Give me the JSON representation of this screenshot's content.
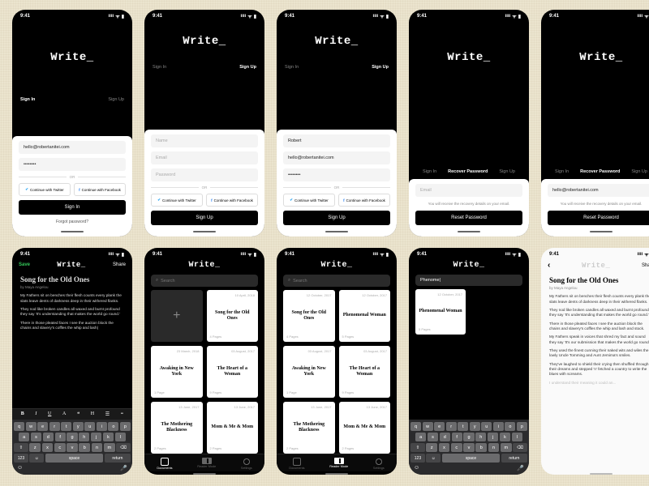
{
  "status": {
    "time": "9:41",
    "net": "ıııı",
    "wifi": "ᯤ",
    "bat": "▮"
  },
  "logo": "Write_",
  "auth": {
    "signin": "Sign In",
    "signup": "Sign Up",
    "recover": "Recover Password",
    "name_ph": "Name",
    "email_ph": "Email",
    "pass_ph": "Password",
    "email_val": "hello@robertanitei.com",
    "name_val": "Robert",
    "pass_val": "••••••••",
    "or": "OR",
    "tw": "Continue with Twitter",
    "fb": "Continue with Facebook",
    "btn_signin": "Sign In",
    "btn_signup": "Sign Up",
    "btn_reset": "Reset Password",
    "forgot": "Forgot password?",
    "note": "You will receive the recovery details on your email."
  },
  "editor": {
    "save": "Save",
    "share": "Share",
    "title": "Song for the Old Ones",
    "byline": "by Maya Angelou",
    "p1": "My Fathers sit on benches their flesh counts every plank the slats leave dents of darkness deep in their withered flanks.",
    "p2": "They nod like broken candles all waxed and burnt profound they say 'It's understanding that makes the world go round.'",
    "p3": "There in those pleated faces I see the auction block the chains and slavery's coffles the whip and lash|",
    "p3b": "There in those pleated faces I see the auction block the chains and slavery's coffles the whip and lash and stock.",
    "p4": "My Fathers speak in voices that shred my fact and sound they say 'It's our submission that makes the world go round.'",
    "p5": "They used the finest cunning their naked wits and wiles the lowly Uncle Tomming and Aunt Jemima's smiles.",
    "p6": "They've laughed to shield their crying then shuffled through their dreams and stepped 'n' fetched a country to write the blues with screams.",
    "p7": "I understand their meaning it could an..."
  },
  "fmt": {
    "b": "B",
    "i": "I",
    "u": "U",
    "a": "A",
    "q": "❝",
    "h": "H",
    "list": "☰",
    "al": "≡"
  },
  "kb": {
    "r1": [
      "q",
      "w",
      "e",
      "r",
      "t",
      "y",
      "u",
      "i",
      "o",
      "p"
    ],
    "r2": [
      "a",
      "s",
      "d",
      "f",
      "g",
      "h",
      "j",
      "k",
      "l"
    ],
    "shift": "⇧",
    "del": "⌫",
    "r3": [
      "z",
      "x",
      "c",
      "v",
      "b",
      "n",
      "m"
    ],
    "num": "123",
    "emoji": "☺",
    "space": "space",
    "ret": "return",
    "mic": "🎤"
  },
  "lib": {
    "search_ph": "Search",
    "search_val": "Phenome|",
    "cards": [
      {
        "date": "10 April, 2018",
        "title": "Song for the Old Ones",
        "pages": "4 Pages"
      },
      {
        "date": "23 March, 2018",
        "title": "Awaking in New York",
        "pages": "1 Page"
      },
      {
        "date": "03 August, 2017",
        "title": "The Heart of a Woman",
        "pages": "9 Pages"
      },
      {
        "date": "13 June, 2017",
        "title": "The Mothering Blackness",
        "pages": "2 Pages"
      },
      {
        "date": "13 June, 2017",
        "title": "Mom & Me & Mom",
        "pages": "2 Pages"
      },
      {
        "date": "12 October, 2017",
        "title": "Phenomenal Woman",
        "pages": "5 Pages"
      }
    ],
    "tabs": {
      "docs": "Documents",
      "reader": "Reader Mode",
      "settings": "Settings"
    }
  }
}
